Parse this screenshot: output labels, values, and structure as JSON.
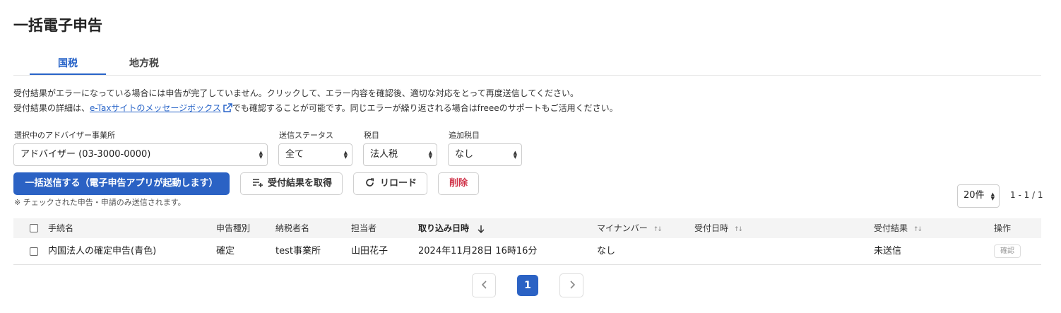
{
  "page": {
    "title": "一括電子申告"
  },
  "tabs": [
    {
      "label": "国税",
      "active": true
    },
    {
      "label": "地方税",
      "active": false
    }
  ],
  "description": {
    "line1": "受付結果がエラーになっている場合には申告が完了していません。クリックして、エラー内容を確認後、適切な対応をとって再度送信してください。",
    "line2_prefix": "受付結果の詳細は、",
    "line2_link": "e-Taxサイトのメッセージボックス",
    "line2_link_icon": "external-link-icon",
    "line2_suffix": "でも確認することが可能です。同じエラーが繰り返される場合はfreeeのサポートもご活用ください。"
  },
  "filters": {
    "advisor": {
      "label": "選択中のアドバイザー事業所",
      "value": "アドバイザー (03-3000-0000)"
    },
    "status": {
      "label": "送信ステータス",
      "value": "全て"
    },
    "tax_item": {
      "label": "税目",
      "value": "法人税"
    },
    "additional_tax": {
      "label": "追加税目",
      "value": "なし"
    }
  },
  "actions": {
    "bulk_send": "一括送信する（電子申告アプリが起動します）",
    "fetch_results": "受付結果を取得",
    "fetch_results_icon": "list-add-icon",
    "reload": "リロード",
    "reload_icon": "refresh-icon",
    "delete": "削除"
  },
  "note": "※ チェックされた申告・申請のみ送信されます。",
  "pagination": {
    "per_page": "20件",
    "range": "1 - 1 / 1",
    "current_page": "1",
    "prev_icon": "chevron-left-icon",
    "next_icon": "chevron-right-icon"
  },
  "table": {
    "headers": {
      "procedure": "手続名",
      "type": "申告種別",
      "taxpayer": "納税者名",
      "assignee": "担当者",
      "imported_at": "取り込み日時",
      "my_number": "マイナンバー",
      "received_at": "受付日時",
      "result": "受付結果",
      "operation": "操作"
    },
    "rows": [
      {
        "procedure": "内国法人の確定申告(青色)",
        "type": "確定",
        "taxpayer": "test事業所",
        "assignee": "山田花子",
        "imported_at": "2024年11月28日 16時16分",
        "my_number": "なし",
        "received_at": "",
        "result": "未送信",
        "operation": "確認"
      }
    ]
  },
  "colors": {
    "primary": "#2b62c4",
    "link": "#2864c8",
    "danger": "#d0354b",
    "header_bg": "#f4f4f4"
  }
}
